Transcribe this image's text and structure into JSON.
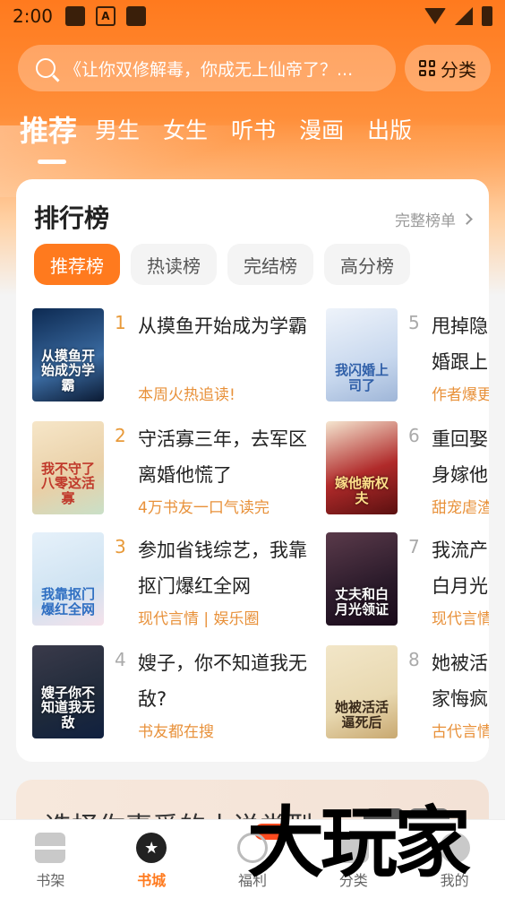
{
  "status_bar": {
    "time": "2:00"
  },
  "search": {
    "placeholder": "《让你双修解毒，你成无上仙帝了？..."
  },
  "category_button": {
    "label": "分类"
  },
  "tabs": [
    {
      "label": "推荐",
      "active": true
    },
    {
      "label": "男生"
    },
    {
      "label": "女生"
    },
    {
      "label": "听书"
    },
    {
      "label": "漫画"
    },
    {
      "label": "出版"
    }
  ],
  "ranking": {
    "title": "排行榜",
    "more": "完整榜单",
    "chips": [
      "推荐榜",
      "热读榜",
      "完结榜",
      "高分榜"
    ],
    "books": [
      {
        "rank": "1",
        "title": "从摸鱼开始成为学霸",
        "tag": "本周火热追读!",
        "cover_text": "从摸鱼开始成为学霸",
        "cover_color": "#1c3f6e"
      },
      {
        "rank": "2",
        "title": "守活寡三年，去军区离婚他慌了",
        "tag": "4万书友一口气读完",
        "cover_text": "我不守了八零这活寡",
        "cover_color": "#e9cfa6"
      },
      {
        "rank": "3",
        "title": "参加省钱综艺，我靠抠门爆红全网",
        "tag": "现代言情 | 娱乐圈",
        "cover_text": "我靠抠门爆红全网",
        "cover_color": "#cfe3f2"
      },
      {
        "rank": "4",
        "title": "嫂子，你不知道我无敌?",
        "tag": "书友都在搜",
        "cover_text": "嫂子你不知道我无敌",
        "cover_color": "#2a2a3a"
      },
      {
        "rank": "5",
        "title": "甩掉隐婚老公，我闪婚跟上司",
        "tag": "作者爆更",
        "cover_text": "我闪婚上司了",
        "cover_color": "#dce6f3"
      },
      {
        "rank": "6",
        "title": "重回娶妻前夕，我转身嫁他",
        "tag": "甜宠虐渣",
        "cover_text": "嫁他新权夫",
        "cover_color": "#7a1a1a"
      },
      {
        "rank": "7",
        "title": "我流产那天，丈夫和白月光领证",
        "tag": "现代言情",
        "cover_text": "丈夫和白月光领证",
        "cover_color": "#3a2a3a"
      },
      {
        "rank": "8",
        "title": "她被活活逼死后，全家悔疯了",
        "tag": "古代言情",
        "cover_text": "她被活活逼死后",
        "cover_color": "#e8d8b0"
      }
    ]
  },
  "genre_card": {
    "title": "选择你喜爱的小说类型"
  },
  "bottom_nav": [
    {
      "label": "书架"
    },
    {
      "label": "书城",
      "active": true
    },
    {
      "label": "福利"
    },
    {
      "label": "分类"
    },
    {
      "label": "我的"
    }
  ],
  "watermark": "大玩家"
}
